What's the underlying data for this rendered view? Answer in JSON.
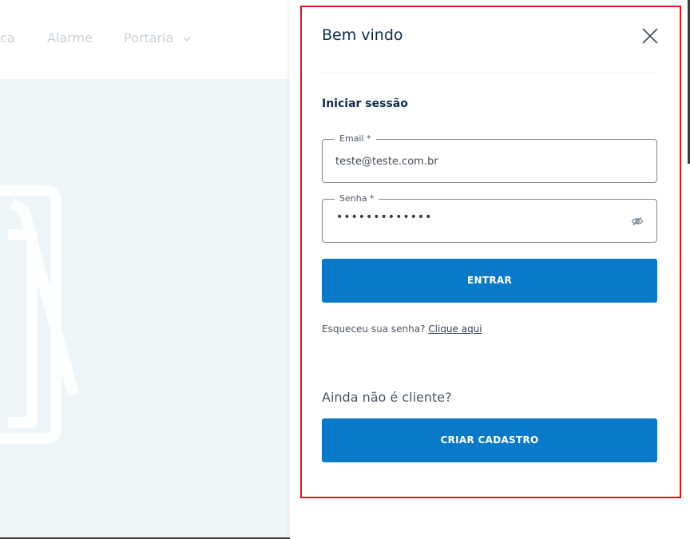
{
  "background": {
    "nav": [
      "ca",
      "Alarme",
      "Portaria"
    ],
    "portaria_chevron": "chevron-down-icon"
  },
  "modal": {
    "title": "Bem vindo",
    "close_icon": "close-icon",
    "section_title": "Iniciar sessão",
    "email": {
      "label": "Email *",
      "value": "teste@teste.com.br"
    },
    "password": {
      "label": "Senha *",
      "masked_value": "•••••••••••••",
      "toggle_icon": "eye-off-icon"
    },
    "login_button": "ENTRAR",
    "forgot": {
      "text": "Esqueceu sua senha?",
      "link": "Clique aqui"
    },
    "not_client": "Ainda não é cliente?",
    "signup_button": "CRIAR CADASTRO"
  },
  "colors": {
    "primary": "#0a7ac8",
    "title": "#0e2d4a",
    "highlight": "#e0141e",
    "hero_bg": "#eef5f8"
  }
}
